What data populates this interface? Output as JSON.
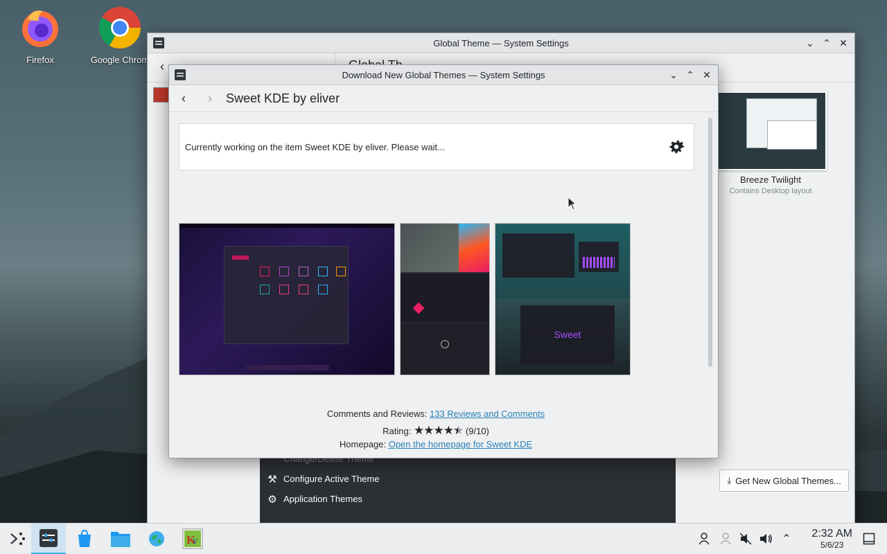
{
  "desktop": {
    "icons": [
      {
        "label": "Firefox"
      },
      {
        "label": "Google Chrom"
      }
    ]
  },
  "back_window": {
    "title": "Global Theme — System Settings",
    "header_partial": "Global Th",
    "theme_card": {
      "name": "Breeze Twilight",
      "subtitle": "Contains Desktop layout"
    },
    "menu_items": [
      {
        "label": "Change/Delete Theme",
        "icon": "trash-icon"
      },
      {
        "label": "Configure Active Theme",
        "icon": "wrench-icon"
      },
      {
        "label": "Application Themes",
        "icon": "gear-icon"
      }
    ],
    "get_new_button": "Get New Global Themes..."
  },
  "dialog": {
    "title": "Download New Global Themes — System Settings",
    "heading": "Sweet KDE by eliver",
    "status_message": "Currently working on the item Sweet KDE by eliver. Please wait...",
    "sweet_label": "Sweet",
    "comments_label": "Comments and Reviews:",
    "comments_link": "133 Reviews and Comments",
    "rating_label": "Rating:",
    "rating_value": 9,
    "rating_max": 10,
    "rating_text": "(9/10)",
    "homepage_label": "Homepage:",
    "homepage_link": "Open the homepage for Sweet KDE"
  },
  "taskbar": {
    "time": "2:32 AM",
    "date": "5/6/23"
  }
}
